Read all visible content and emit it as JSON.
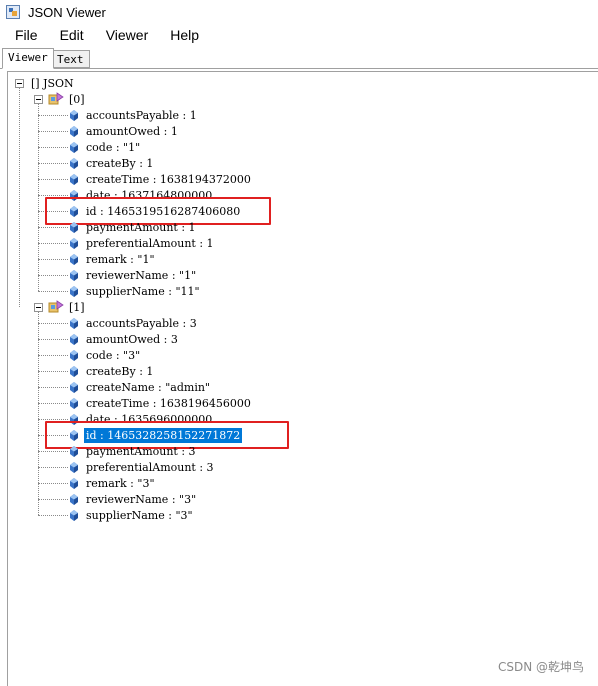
{
  "window": {
    "title": "JSON Viewer"
  },
  "menu": [
    "File",
    "Edit",
    "Viewer",
    "Help"
  ],
  "tabs": {
    "viewer": "Viewer",
    "text": "Text"
  },
  "tree": {
    "root": "[] JSON",
    "items": [
      {
        "label": "[0]",
        "fields": [
          "accountsPayable : 1",
          "amountOwed : 1",
          "code : \"1\"",
          "createBy : 1",
          "createTime : 1638194372000",
          "date : 1637164800000",
          "id : 1465319516287406080",
          "paymentAmount : 1",
          "preferentialAmount : 1",
          "remark : \"1\"",
          "reviewerName : \"1\"",
          "supplierName : \"11\""
        ]
      },
      {
        "label": "[1]",
        "fields": [
          "accountsPayable : 3",
          "amountOwed : 3",
          "code : \"3\"",
          "createBy : 1",
          "createName : \"admin\"",
          "createTime : 1638196456000",
          "date : 1635696000000",
          "id : 1465328258152271872",
          "paymentAmount : 3",
          "preferentialAmount : 3",
          "remark : \"3\"",
          "reviewerName : \"3\"",
          "supplierName : \"3\""
        ]
      }
    ],
    "selected_item": 1,
    "selected_field": 7,
    "highlighted": [
      {
        "item": 0,
        "field": 6
      },
      {
        "item": 1,
        "field": 7
      }
    ]
  },
  "watermark": "CSDN @乾坤鸟",
  "colors": {
    "highlight": "#e02020",
    "selection": "#0078d7"
  }
}
